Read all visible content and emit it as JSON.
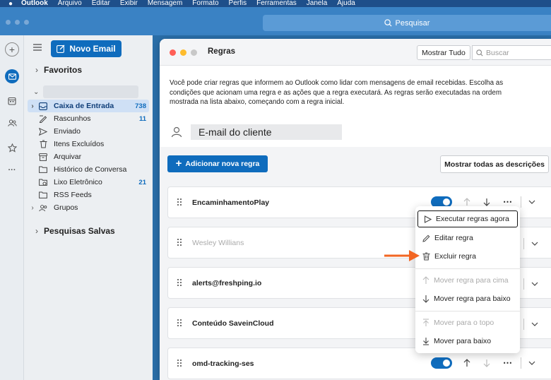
{
  "menubar": {
    "app": "Outlook",
    "items": [
      "Arquivo",
      "Editar",
      "Exibir",
      "Mensagem",
      "Formato",
      "Perfis",
      "Ferramentas",
      "Janela",
      "Ajuda"
    ]
  },
  "titlebar": {
    "search_label": "Pesquisar"
  },
  "sidebar": {
    "new_email_label": "Novo Email",
    "favorites_label": "Favoritos",
    "saved_searches_label": "Pesquisas Salvas",
    "folders": [
      {
        "label": "Caixa de Entrada",
        "count": "738",
        "icon": "inbox-icon"
      },
      {
        "label": "Rascunhos",
        "count": "11",
        "icon": "drafts-icon"
      },
      {
        "label": "Enviado",
        "count": "",
        "icon": "sent-icon"
      },
      {
        "label": "Itens Excluídos",
        "count": "",
        "icon": "trash-icon"
      },
      {
        "label": "Arquivar",
        "count": "",
        "icon": "archive-icon"
      },
      {
        "label": "Histórico de Conversa",
        "count": "",
        "icon": "folder-icon"
      },
      {
        "label": "Lixo Eletrônico",
        "count": "21",
        "icon": "junk-icon"
      },
      {
        "label": "RSS Feeds",
        "count": "",
        "icon": "folder-icon"
      },
      {
        "label": "Grupos",
        "count": "",
        "icon": "groups-icon"
      }
    ]
  },
  "dialog": {
    "title": "Regras",
    "show_all_label": "Mostrar Tudo",
    "search_placeholder": "Buscar",
    "description": "Você pode criar regras que informem ao Outlook como lidar com mensagens de email recebidas. Escolha as condições que acionam uma regra e as ações que a regra executará. As regras serão executadas na ordem mostrada na lista abaixo, começando com a regra inicial.",
    "account": "E-mail do cliente",
    "add_rule_label": "Adicionar nova regra",
    "show_descriptions_label": "Mostrar todas as descrições",
    "rules": [
      {
        "name": "EncaminhamentoPlay",
        "enabled": true
      },
      {
        "name": "Wesley Willians",
        "enabled": false
      },
      {
        "name": "alerts@freshping.io",
        "enabled": false
      },
      {
        "name": "Conteúdo SaveinCloud",
        "enabled": false
      },
      {
        "name": "omd-tracking-ses",
        "enabled": true
      }
    ]
  },
  "context_menu": {
    "items": [
      {
        "label": "Executar regras agora",
        "enabled": true,
        "icon": "play-icon"
      },
      {
        "label": "Editar regra",
        "enabled": true,
        "icon": "pencil-icon"
      },
      {
        "label": "Excluir regra",
        "enabled": true,
        "icon": "trash-icon"
      },
      {
        "label": "Mover regra para cima",
        "enabled": false,
        "icon": "arrow-up-icon"
      },
      {
        "label": "Mover regra para baixo",
        "enabled": true,
        "icon": "arrow-down-icon"
      },
      {
        "label": "Mover para o topo",
        "enabled": false,
        "icon": "arrow-to-top-icon"
      },
      {
        "label": "Mover para baixo",
        "enabled": true,
        "icon": "arrow-to-bottom-icon"
      }
    ]
  },
  "colors": {
    "accent": "#0f6cbd",
    "annotation_arrow": "#f26522"
  }
}
